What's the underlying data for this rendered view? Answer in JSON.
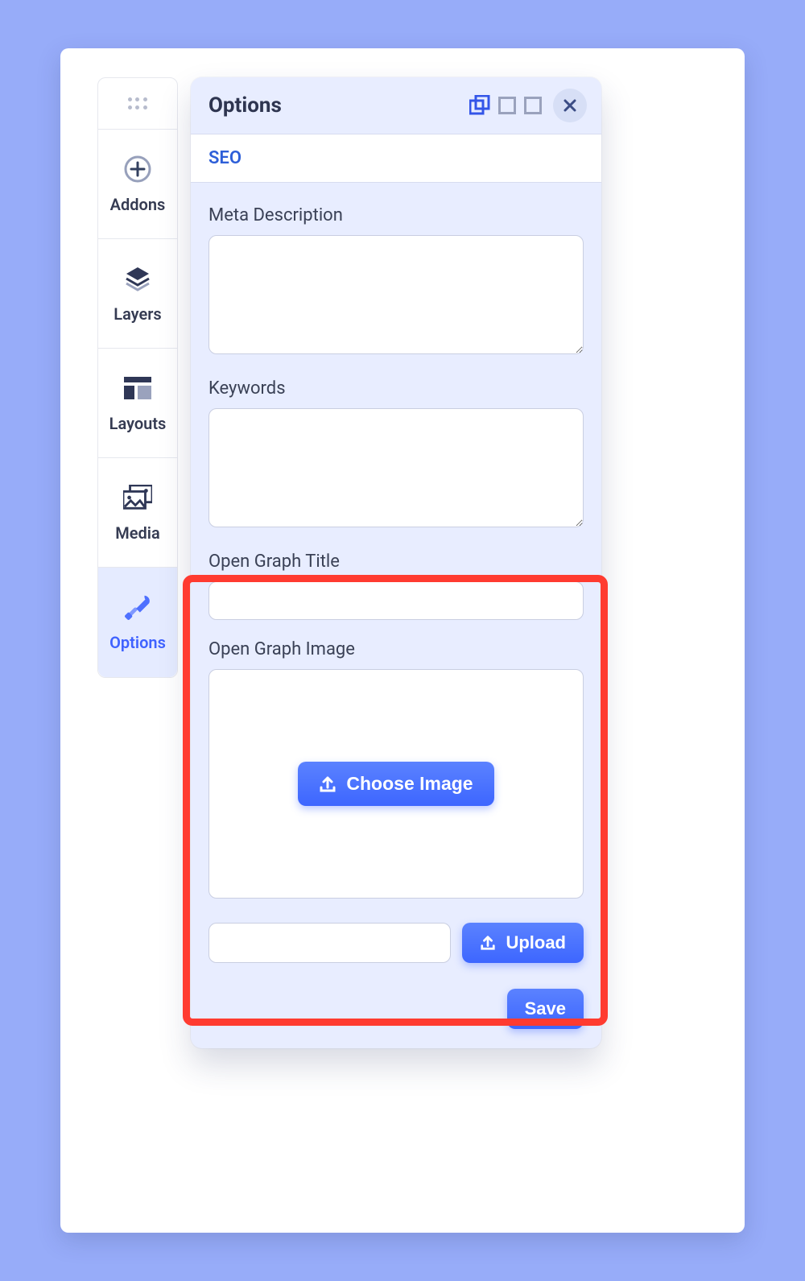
{
  "sidebar": {
    "items": [
      {
        "label": "Addons"
      },
      {
        "label": "Layers"
      },
      {
        "label": "Layouts"
      },
      {
        "label": "Media"
      },
      {
        "label": "Options"
      }
    ]
  },
  "panel": {
    "title": "Options",
    "tab_seo": "SEO",
    "meta_description_label": "Meta Description",
    "meta_description_value": "",
    "keywords_label": "Keywords",
    "keywords_value": "",
    "og_title_label": "Open Graph Title",
    "og_title_value": "",
    "og_image_label": "Open Graph Image",
    "choose_image_label": "Choose Image",
    "upload_path_value": "",
    "upload_label": "Upload",
    "save_label": "Save"
  },
  "colors": {
    "accent": "#3d66ff",
    "highlight": "#ff3b30",
    "panel_bg": "#e8edff"
  }
}
